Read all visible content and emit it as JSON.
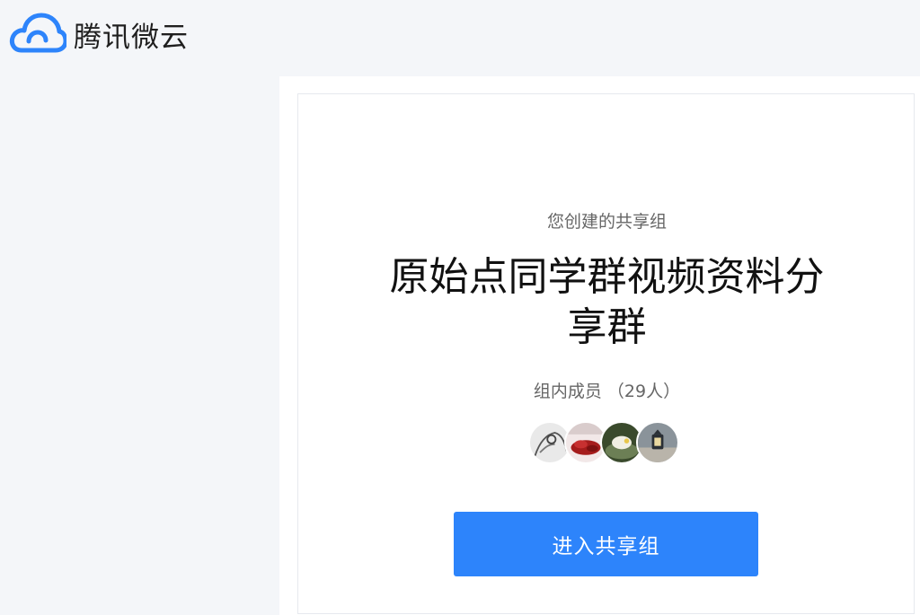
{
  "app": {
    "logo_text": "腾讯微云",
    "logo_icon": "cloud-icon",
    "brand_color": "#2d84fb"
  },
  "share_group": {
    "subtitle": "您创建的共享组",
    "name": "原始点同学群视频资料分享群",
    "members_label": "组内成员 （29人）",
    "member_avatars": [
      "member-avatar-1",
      "member-avatar-2",
      "member-avatar-3",
      "member-avatar-4"
    ],
    "enter_button_label": "进入共享组"
  }
}
